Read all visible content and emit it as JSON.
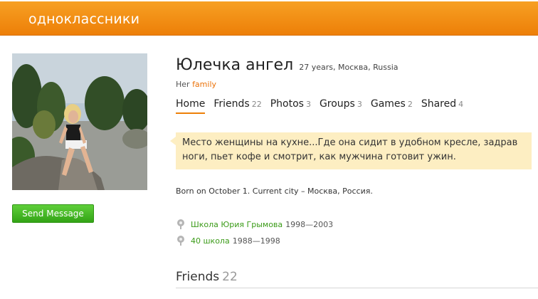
{
  "header": {
    "logo_text": "одноклассники"
  },
  "profile": {
    "name": "Юлечка ангел",
    "meta": "27 years, Москва, Russia",
    "family_prefix": "Her",
    "family_link": "family"
  },
  "tabs": [
    {
      "label": "Home",
      "count": ""
    },
    {
      "label": "Friends",
      "count": "22"
    },
    {
      "label": "Photos",
      "count": "3"
    },
    {
      "label": "Groups",
      "count": "3"
    },
    {
      "label": "Games",
      "count": "2"
    },
    {
      "label": "Shared",
      "count": "4"
    }
  ],
  "status_text": "Место женщины на кухне...Где она сидит в удобном кресле, задрав ноги, пьет кофе и смотрит, как мужчина готовит ужин.",
  "born_text": "Born on October 1. Current city – Москва, Россия.",
  "schools": [
    {
      "name": "Школа Юрия Грымова",
      "years": "1998—2003"
    },
    {
      "name": "40 школа",
      "years": "1988—1998"
    }
  ],
  "actions": {
    "send_message": "Send Message"
  },
  "friends_section": {
    "title": "Friends",
    "count": "22"
  },
  "colors": {
    "brand_orange": "#ed7f08",
    "button_green": "#3fb21f",
    "link_green": "#3b9b18",
    "status_bg": "#fdeec2"
  }
}
